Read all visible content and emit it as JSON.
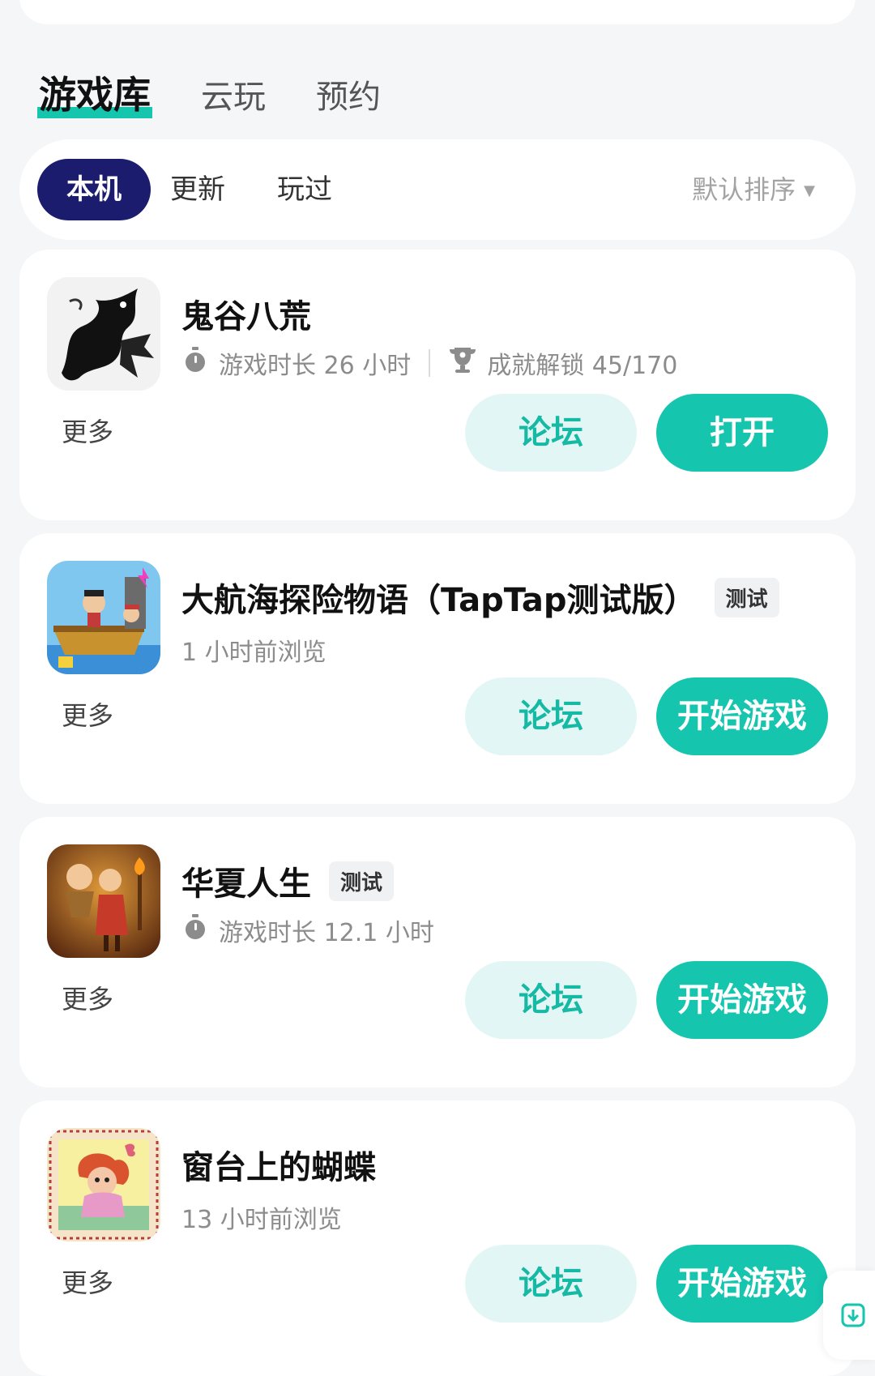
{
  "tabs": [
    {
      "label": "游戏库",
      "active": true
    },
    {
      "label": "云玩",
      "active": false
    },
    {
      "label": "预约",
      "active": false
    }
  ],
  "filters": {
    "chips": [
      "本机",
      "更新",
      "玩过"
    ],
    "active": "本机",
    "sort_label": "默认排序"
  },
  "games": [
    {
      "title": "鬼谷八荒",
      "tag": "",
      "playtime": "游戏时长 26 小时",
      "achievements": "成就解锁 45/170",
      "more": "更多",
      "forum_label": "论坛",
      "action_label": "打开",
      "icon": "ghost-valley-dragon-icon"
    },
    {
      "title": "大航海探险物语（TapTap测试版）",
      "tag": "测试",
      "subtitle": "1 小时前浏览",
      "more": "更多",
      "forum_label": "论坛",
      "action_label": "开始游戏",
      "icon": "pirate-ship-icon"
    },
    {
      "title": "华夏人生",
      "tag": "测试",
      "playtime": "游戏时长 12.1 小时",
      "more": "更多",
      "forum_label": "论坛",
      "action_label": "开始游戏",
      "icon": "ancient-china-life-icon"
    },
    {
      "title": "窗台上的蝴蝶",
      "tag": "",
      "subtitle": "13 小时前浏览",
      "more": "更多",
      "forum_label": "论坛",
      "action_label": "开始游戏",
      "icon": "butterfly-stamp-icon"
    }
  ],
  "colors": {
    "accent": "#15c5ae",
    "accent_light": "#e2f7f5",
    "chip_active": "#1c1c6e",
    "background": "#f4f6f8"
  }
}
